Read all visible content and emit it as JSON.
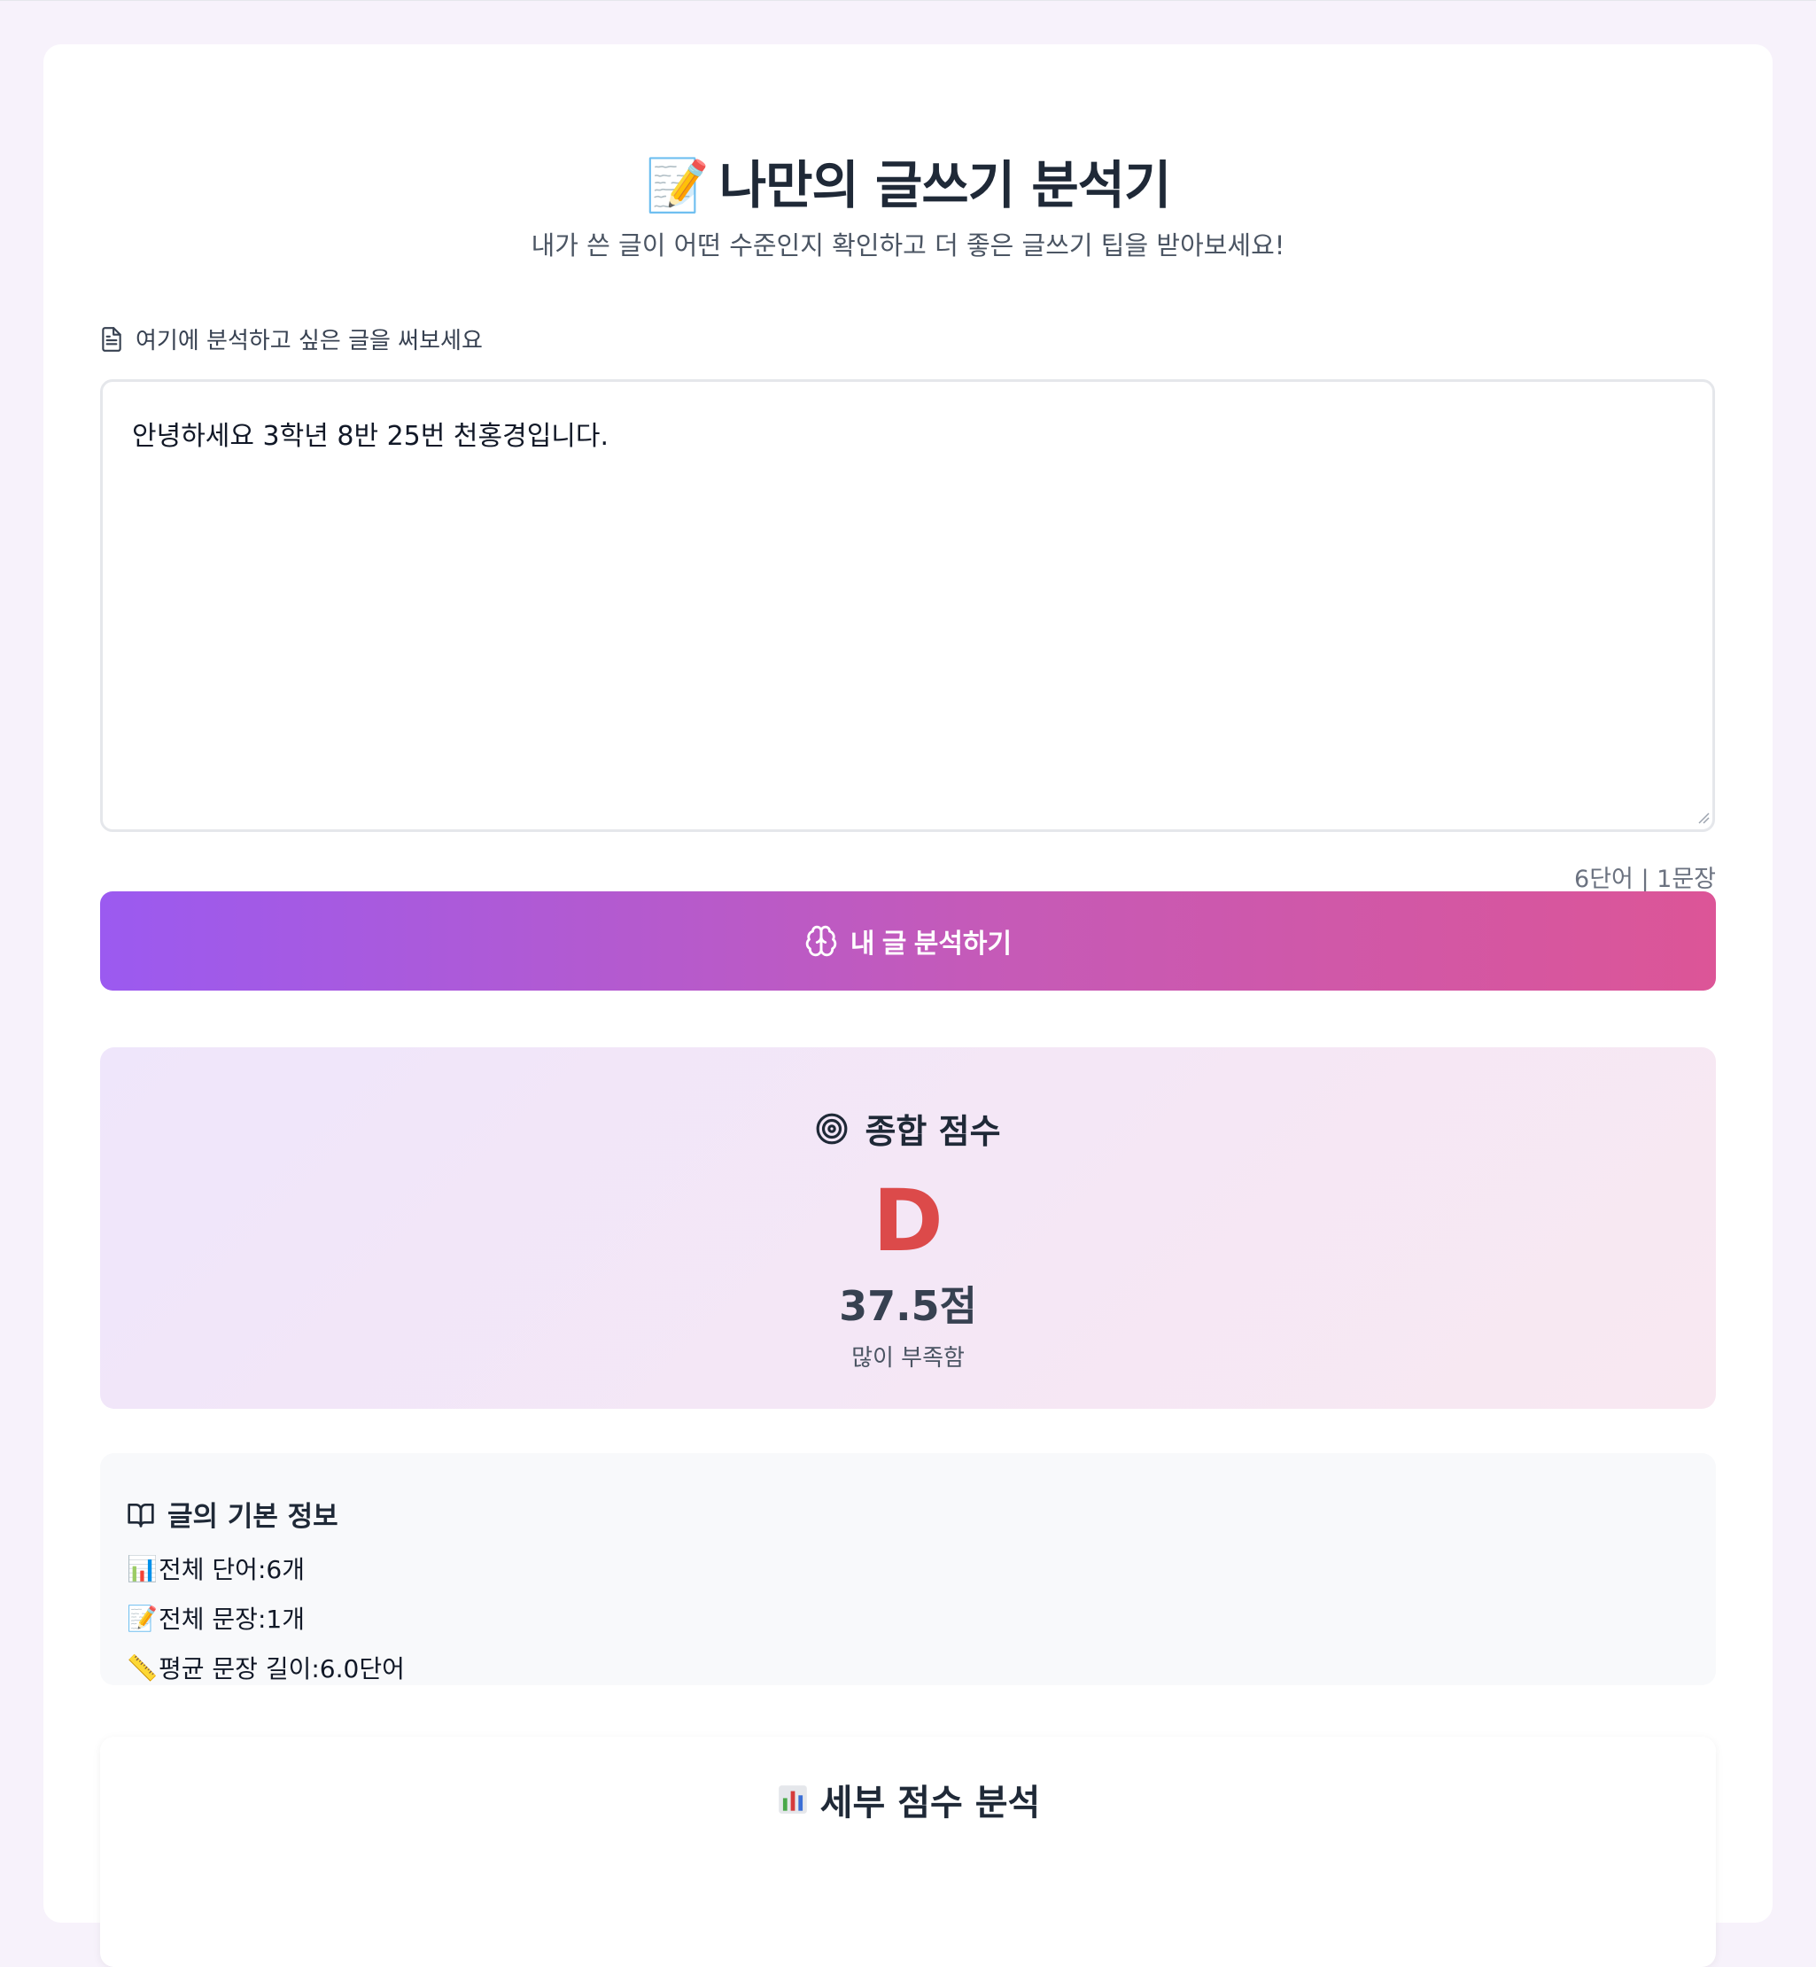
{
  "header": {
    "title_emoji": "📝",
    "title": "나만의 글쓰기 분석기",
    "subtitle": "내가 쓴 글이 어떤 수준인지 확인하고 더 좋은 글쓰기 팁을 받아보세요!"
  },
  "input": {
    "label": "여기에 분석하고 싶은 글을 써보세요",
    "value": "안녕하세요 3학년 8반 25번 천홍경입니다.",
    "counter": "6단어 | 1문장"
  },
  "analyze_button": {
    "label": "내 글 분석하기"
  },
  "score": {
    "title": "종합 점수",
    "grade": "D",
    "points": "37.5점",
    "verdict": "많이 부족함",
    "grade_color": "#dc4a4a"
  },
  "basic_info": {
    "title": "글의 기본 정보",
    "items": [
      {
        "icon": "📊",
        "label": "전체 단어: ",
        "value": "6개"
      },
      {
        "icon": "📝",
        "label": "전체 문장: ",
        "value": "1개"
      },
      {
        "icon": "📏",
        "label": "평균 문장 길이: ",
        "value": "6.0단어"
      }
    ]
  },
  "detail": {
    "title": "세부 점수 분석"
  },
  "colors": {
    "accent_start": "#9b5af0",
    "accent_end": "#dc5597"
  }
}
